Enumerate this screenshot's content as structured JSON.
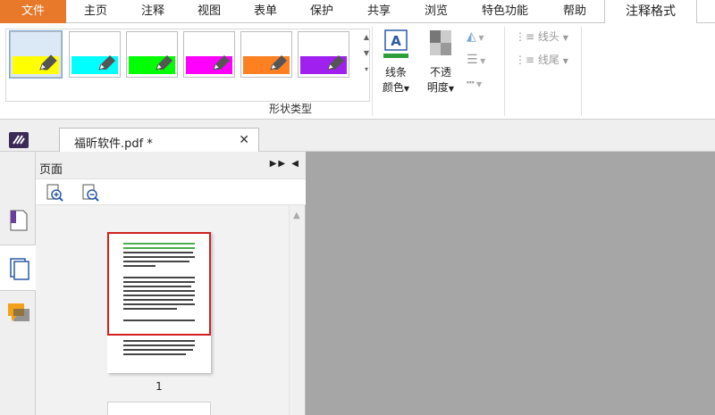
{
  "menubar": {
    "tabs": [
      {
        "label": "文件"
      },
      {
        "label": "主页"
      },
      {
        "label": "注释"
      },
      {
        "label": "视图"
      },
      {
        "label": "表单"
      },
      {
        "label": "保护"
      },
      {
        "label": "共享"
      },
      {
        "label": "浏览"
      },
      {
        "label": "特色功能"
      },
      {
        "label": "帮助"
      },
      {
        "label": "注释格式"
      }
    ],
    "active_tab": "注释格式"
  },
  "ribbon": {
    "shape_styles": [
      {
        "color": "#ffff00",
        "selected": true
      },
      {
        "color": "#00ffff",
        "selected": false
      },
      {
        "color": "#00ff00",
        "selected": false
      },
      {
        "color": "#ff00ff",
        "selected": false
      },
      {
        "color": "#ff8020",
        "selected": false
      },
      {
        "color": "#a020f0",
        "selected": false
      }
    ],
    "group_label": "形状类型",
    "line_color": {
      "line1": "线条",
      "line2": "颜色"
    },
    "opacity": {
      "line1": "不透",
      "line2": "明度"
    },
    "line_start_label": "线头",
    "line_end_label": "线尾"
  },
  "document_tab": {
    "title": "福昕软件.pdf *"
  },
  "pages_panel": {
    "title": "页面",
    "page_number": "1"
  },
  "colors": {
    "accent": "#e8792a",
    "selection": "#d12020",
    "text_highlight": "#4caf50"
  }
}
